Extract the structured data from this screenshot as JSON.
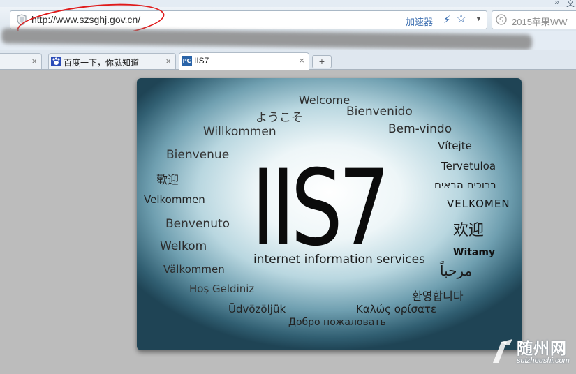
{
  "window": {
    "chevrons": "»",
    "corner_label": "文"
  },
  "address_bar": {
    "url": "http://www.szsghj.gov.cn/",
    "accelerator_label": "加速器"
  },
  "search_box": {
    "text": "2015苹果WW"
  },
  "tabs": [
    {
      "label": "",
      "close": "×"
    },
    {
      "label": "百度一下，你就知道",
      "close": "×"
    },
    {
      "label": "IIS7",
      "close": "×",
      "active": true
    }
  ],
  "new_tab": "+",
  "iis_page": {
    "logo": "IIS7",
    "subtitle": "internet information services",
    "greetings": [
      "Welcome",
      "ようこそ",
      "Bienvenido",
      "Willkommen",
      "Bem-vindo",
      "Vítejte",
      "Bienvenue",
      "Tervetuloa",
      "歡迎",
      "ברוכים הבאים",
      "Velkommen",
      "VELKOMEN",
      "Benvenuto",
      "欢迎",
      "Welkom",
      "Witamy",
      "Välkommen",
      "مرحباً",
      "Hoş Geldiniz",
      "환영합니다",
      "Üdvözöljük",
      "Καλώς ορίσατε",
      "Добро пожаловать"
    ]
  },
  "watermark": {
    "text": "随州网",
    "url": "suizhoushi.com"
  }
}
